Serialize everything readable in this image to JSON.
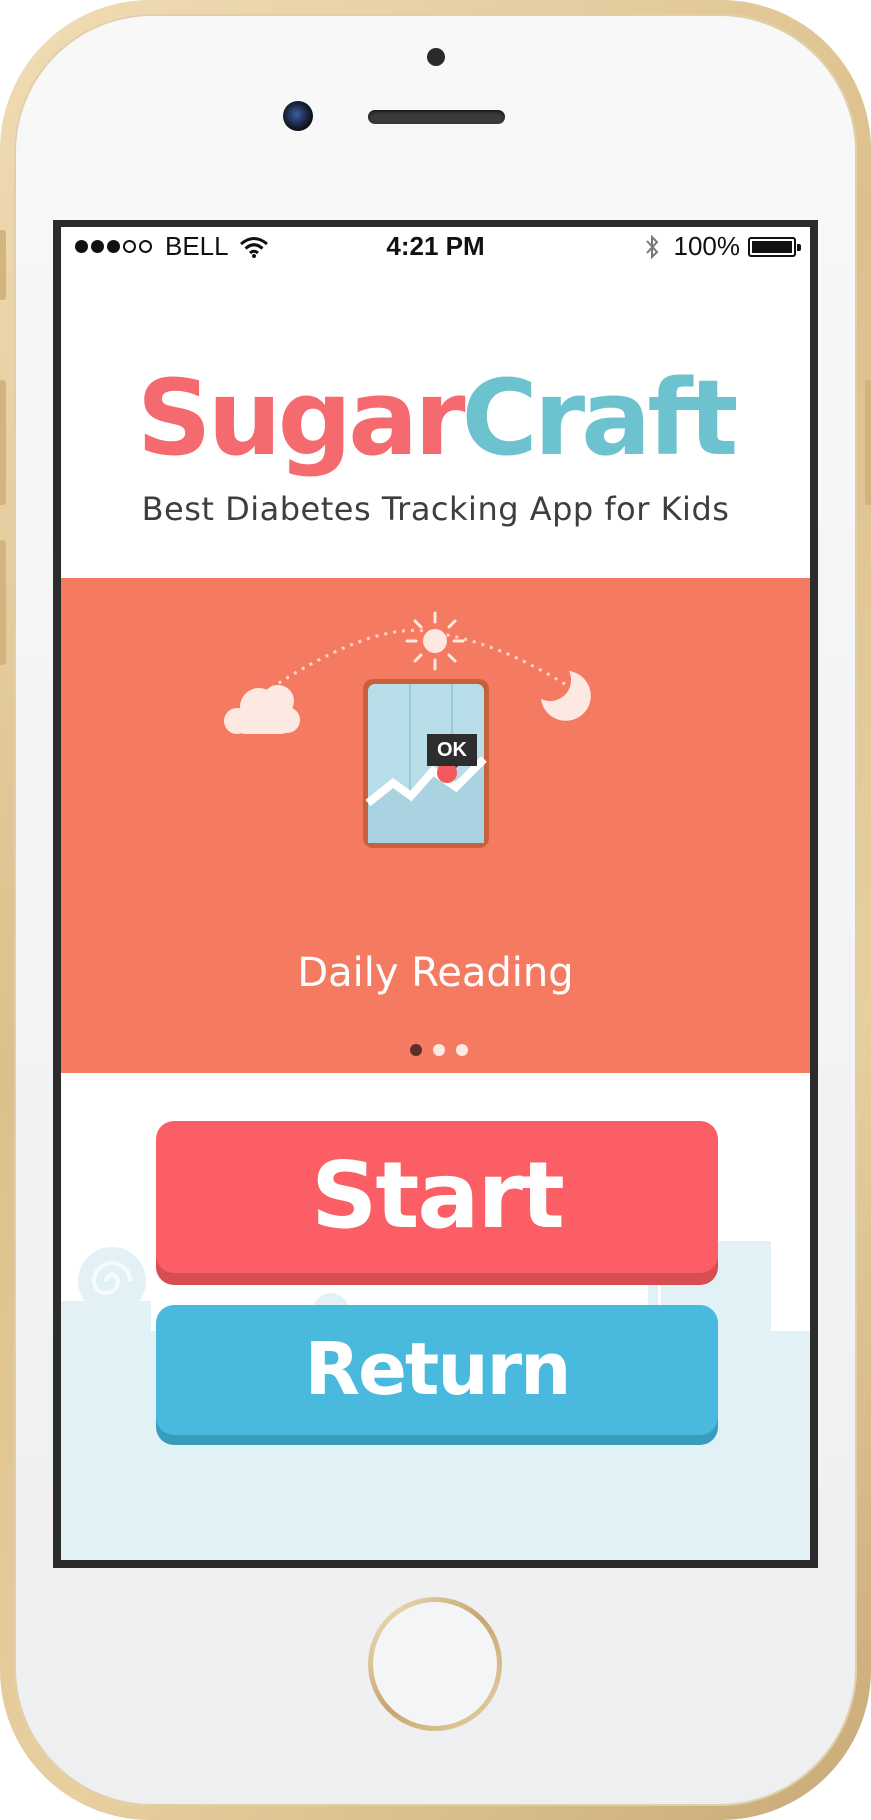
{
  "status_bar": {
    "carrier": "BELL",
    "time": "4:21 PM",
    "battery": "100%",
    "signal_bars_on": 3,
    "signal_bars_total": 5
  },
  "app": {
    "logo_part1": "Sugar",
    "logo_part2": "Craft",
    "tagline": "Best Diabetes Tracking App for Kids"
  },
  "carousel": {
    "slide_caption": "Daily Reading",
    "badge_text": "OK",
    "active_index": 0,
    "count": 3
  },
  "buttons": {
    "start": "Start",
    "return": "Return"
  },
  "colors": {
    "brand_pink": "#f56a6f",
    "brand_teal": "#6cc3cf",
    "carousel_bg": "#f47a61",
    "start_button": "#fb5f65",
    "return_button": "#49b9de",
    "scene_bg": "#e2f1f5"
  },
  "icons": [
    "signal-dots-icon",
    "wifi-icon",
    "bluetooth-icon",
    "battery-icon",
    "sun-icon",
    "cloud-icon",
    "moon-icon",
    "blood-drop-icon"
  ]
}
